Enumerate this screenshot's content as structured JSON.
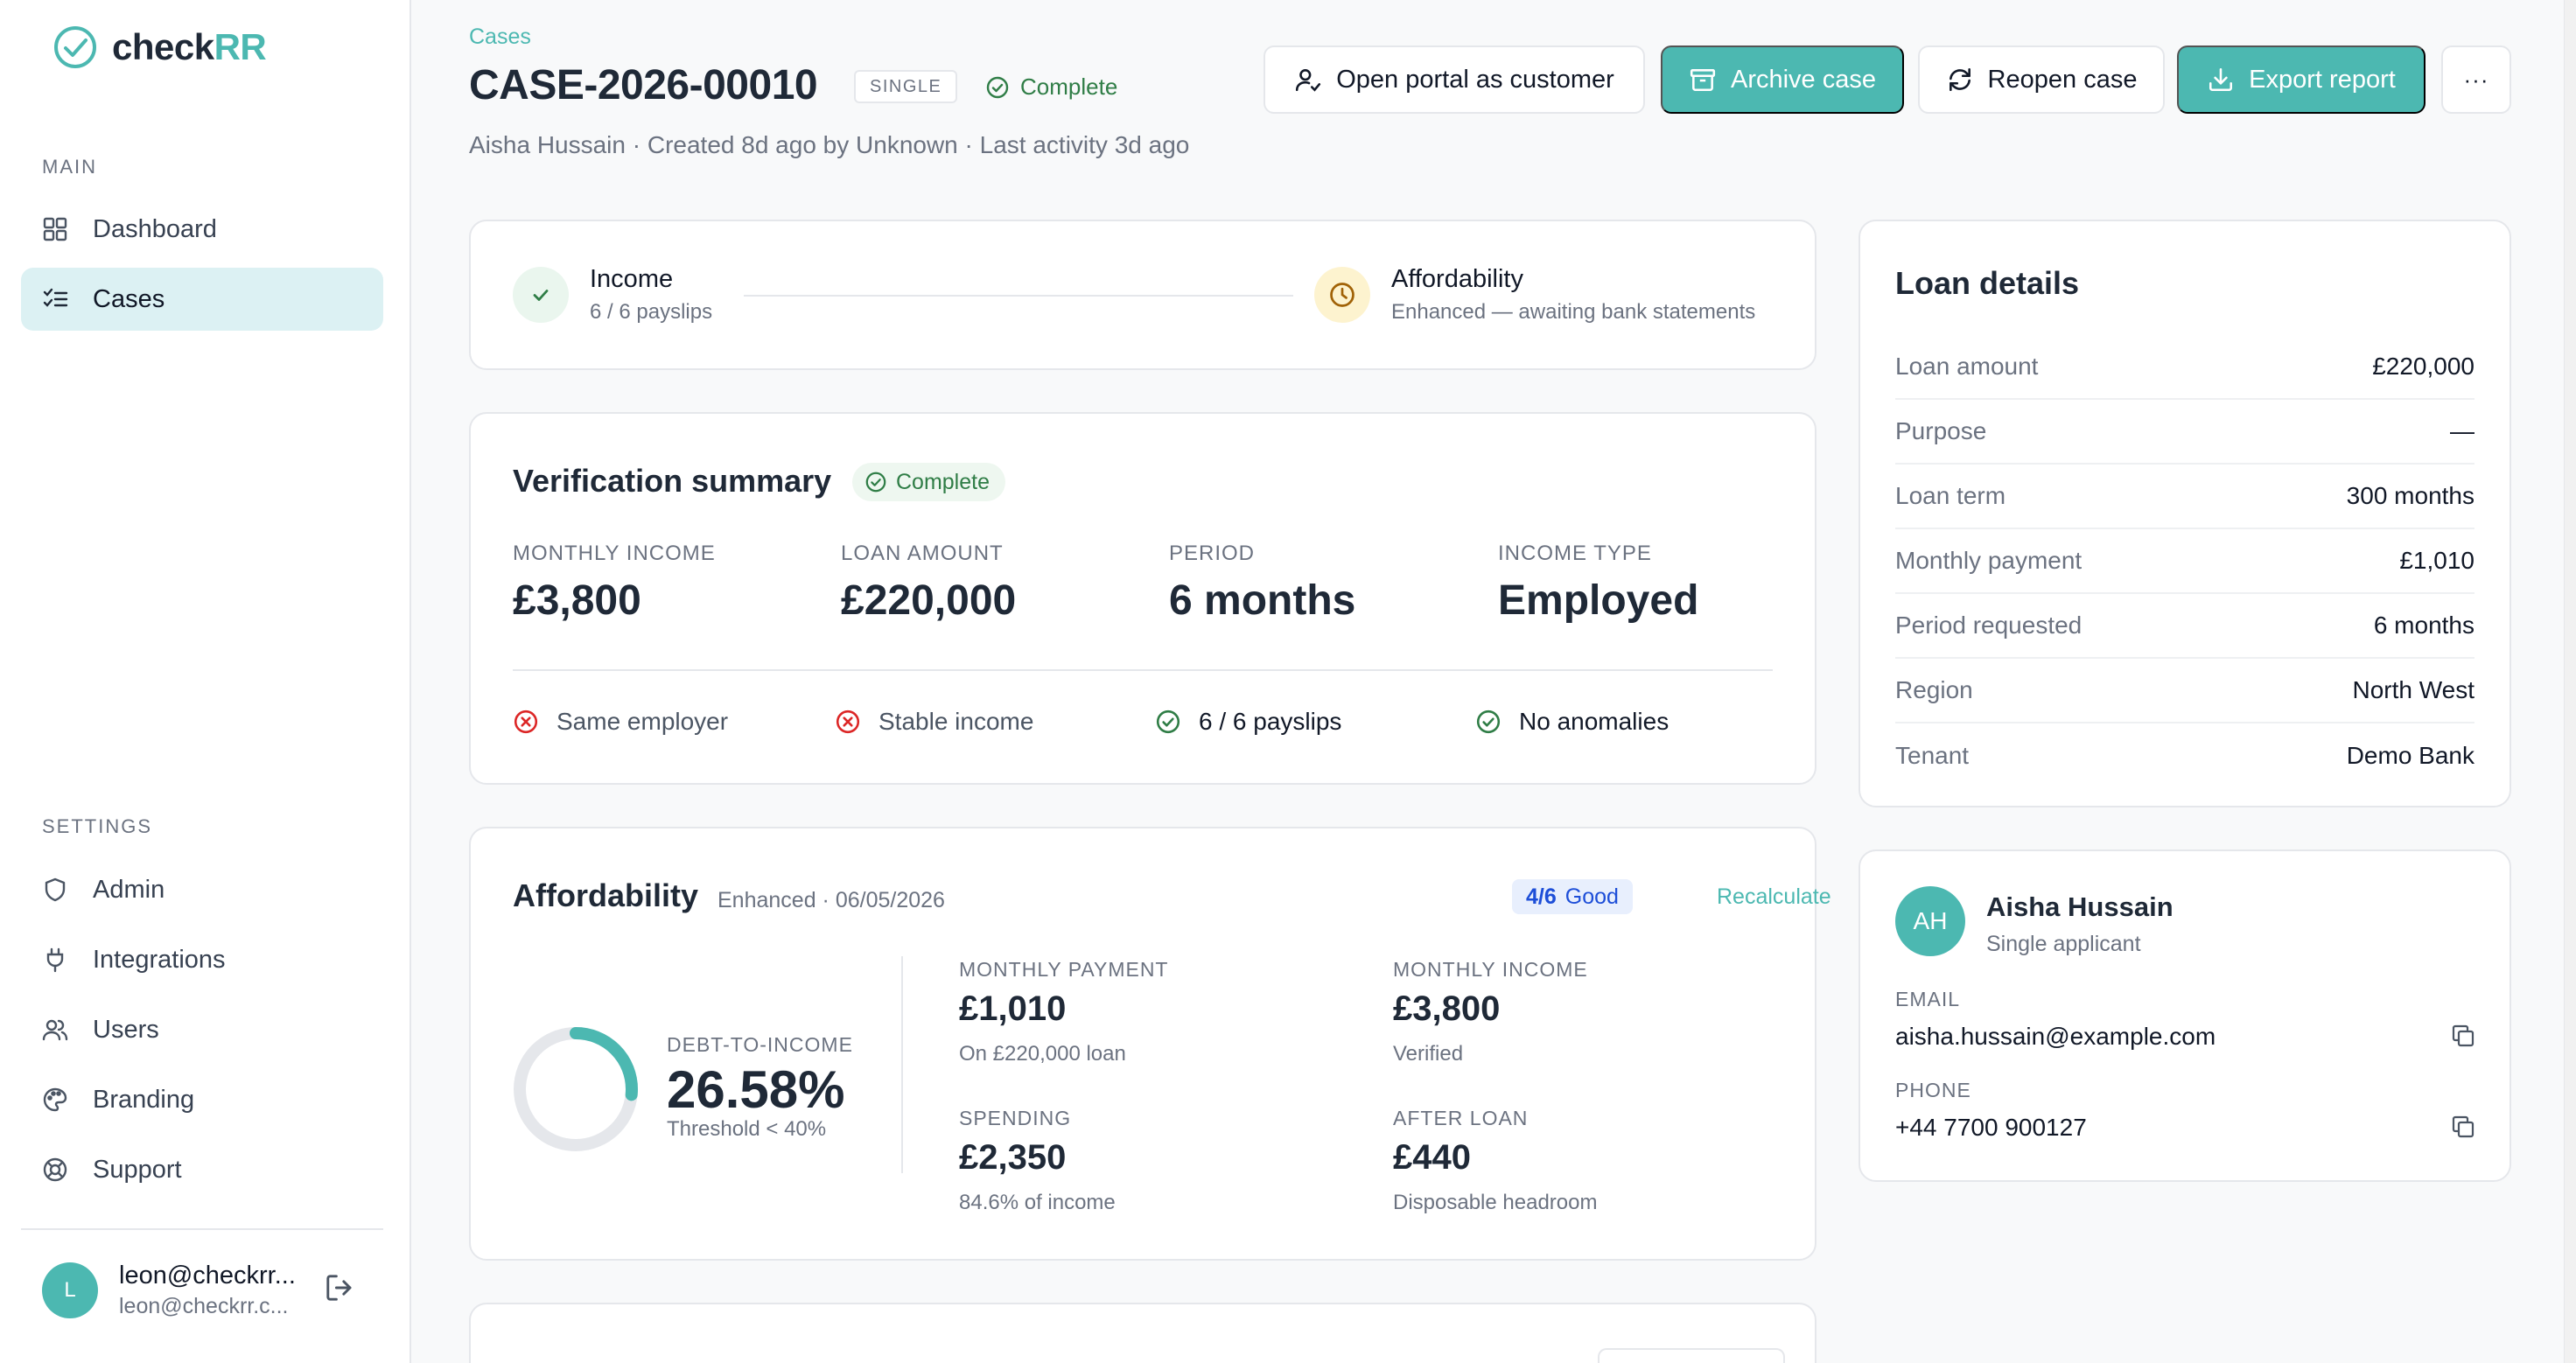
{
  "brand": {
    "name_part1": "check",
    "name_part2": "RR"
  },
  "sidebar": {
    "main_heading": "MAIN",
    "main_items": [
      {
        "label": "Dashboard",
        "icon": "grid-icon"
      },
      {
        "label": "Cases",
        "icon": "list-check-icon",
        "active": true
      }
    ],
    "settings_heading": "SETTINGS",
    "settings_items": [
      {
        "label": "Admin",
        "icon": "shield-icon"
      },
      {
        "label": "Integrations",
        "icon": "plug-icon"
      },
      {
        "label": "Users",
        "icon": "users-icon"
      },
      {
        "label": "Branding",
        "icon": "palette-icon"
      },
      {
        "label": "Support",
        "icon": "lifebuoy-icon"
      }
    ],
    "user": {
      "initial": "L",
      "name": "leon@checkrr...",
      "email": "leon@checkrr.c..."
    }
  },
  "header": {
    "breadcrumb": "Cases",
    "case_id": "CASE-2026-00010",
    "type_badge": "SINGLE",
    "status": "Complete",
    "meta": "Aisha Hussain · Created 8d ago by Unknown · Last activity 3d ago",
    "actions": {
      "open_portal": "Open portal as customer",
      "archive": "Archive case",
      "reopen": "Reopen case",
      "export": "Export report",
      "more": "···"
    }
  },
  "steps": [
    {
      "title": "Income",
      "subtitle": "6 / 6 payslips",
      "state": "done"
    },
    {
      "title": "Affordability",
      "subtitle": "Enhanced — awaiting bank statements",
      "state": "pending"
    }
  ],
  "verification": {
    "title": "Verification summary",
    "status": "Complete",
    "stats": [
      {
        "label": "MONTHLY INCOME",
        "value": "£3,800"
      },
      {
        "label": "LOAN AMOUNT",
        "value": "£220,000"
      },
      {
        "label": "PERIOD",
        "value": "6 months"
      },
      {
        "label": "INCOME TYPE",
        "value": "Employed"
      }
    ],
    "checks": [
      {
        "label": "Same employer",
        "pass": false
      },
      {
        "label": "Stable income",
        "pass": false
      },
      {
        "label": "6 / 6 payslips",
        "pass": true
      },
      {
        "label": "No anomalies",
        "pass": true
      }
    ]
  },
  "affordability": {
    "title": "Affordability",
    "subtitle": "Enhanced · 06/05/2026",
    "score": "4/6",
    "score_label": "Good",
    "recalculate": "Recalculate",
    "dti": {
      "label": "DEBT-TO-INCOME",
      "value": "26.58%",
      "percent": 26.58,
      "threshold": "Threshold < 40%"
    },
    "metrics": [
      {
        "label": "MONTHLY PAYMENT",
        "value": "£1,010",
        "sub": "On £220,000 loan"
      },
      {
        "label": "MONTHLY INCOME",
        "value": "£3,800",
        "sub": "Verified"
      },
      {
        "label": "SPENDING",
        "value": "£2,350",
        "sub": "84.6% of income"
      },
      {
        "label": "AFTER LOAN",
        "value": "£440",
        "sub": "Disposable headroom"
      }
    ]
  },
  "loan": {
    "title": "Loan details",
    "rows": [
      {
        "key": "Loan amount",
        "value": "£220,000"
      },
      {
        "key": "Purpose",
        "value": "—"
      },
      {
        "key": "Loan term",
        "value": "300 months"
      },
      {
        "key": "Monthly payment",
        "value": "£1,010"
      },
      {
        "key": "Period requested",
        "value": "6 months"
      },
      {
        "key": "Region",
        "value": "North West"
      },
      {
        "key": "Tenant",
        "value": "Demo Bank"
      }
    ]
  },
  "applicant": {
    "initials": "AH",
    "name": "Aisha Hussain",
    "role": "Single applicant",
    "email_label": "EMAIL",
    "email": "aisha.hussain@example.com",
    "phone_label": "PHONE",
    "phone": "+44 7700 900127"
  },
  "colors": {
    "accent": "#4cb8b1",
    "success": "#2f7d46",
    "danger": "#dc2626",
    "warning_bg": "#fdf3cf"
  }
}
